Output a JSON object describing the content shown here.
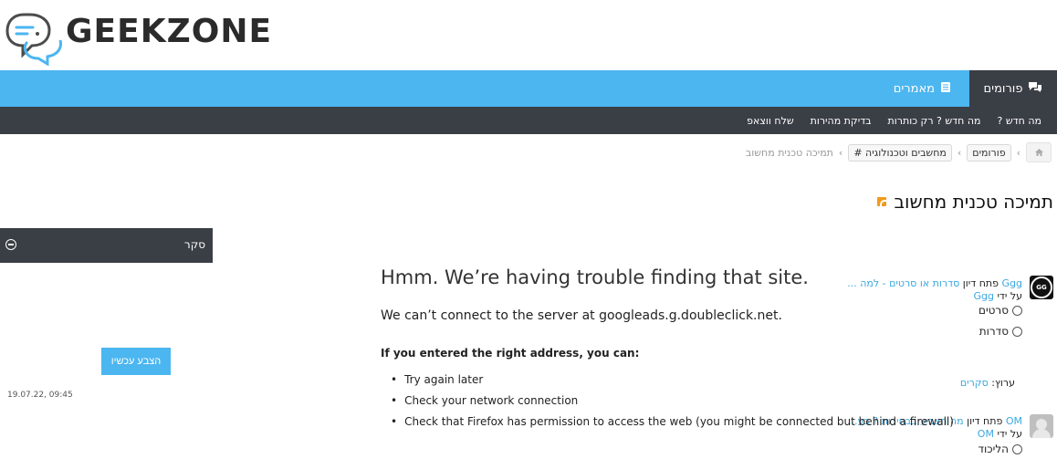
{
  "site": {
    "logo_text": "GEEKZONE"
  },
  "nav": {
    "forums_label": "פורומים",
    "articles_label": "מאמרים"
  },
  "subnav": {
    "items": [
      "מה חדש ?",
      "מה חדש ? רק כותרות",
      "בדיקת מהירות",
      "שלח ווצאפ"
    ]
  },
  "breadcrumb": {
    "items": [
      "פורומים",
      "# מחשבים וטכנולוגיה"
    ],
    "current": "תמיכה טכנית מחשוב"
  },
  "page": {
    "title": "תמיכה טכנית מחשוב"
  },
  "sidebar": {
    "title": "סקר",
    "polls": [
      {
        "author": "Ggg",
        "action": "פתח דיון",
        "topic": "סדרות או סרטים - למה ...",
        "by_prefix": "על ידי",
        "by_user": "Ggg",
        "options": [
          "סרטים",
          "סדרות"
        ],
        "vote_button": "הצבע עכשיו",
        "channel_prefix": "ערוץ:",
        "channel": "סקרים",
        "timestamp": "19.07.22, 09:45"
      },
      {
        "author": "OM",
        "action": "פתח דיון",
        "topic": "מה תצביע בבחירות ? בע...",
        "by_prefix": "על ידי",
        "by_user": "OM",
        "options": [
          "הליכוד"
        ]
      }
    ]
  },
  "error": {
    "title": "Hmm. We’re having trouble finding that site.",
    "description": "We can’t connect to the server at googleads.g.doubleclick.net.",
    "subtitle": "If you entered the right address, you can:",
    "items": [
      "Try again later",
      "Check your network connection",
      "Check that Firefox has permission to access the web (you might be connected but behind a firewall)"
    ]
  },
  "colors": {
    "accent_blue": "#4cb6f0",
    "dark_bar": "#3a3e45",
    "link": "#3aa8e0",
    "rss_orange": "#f29a1f"
  }
}
